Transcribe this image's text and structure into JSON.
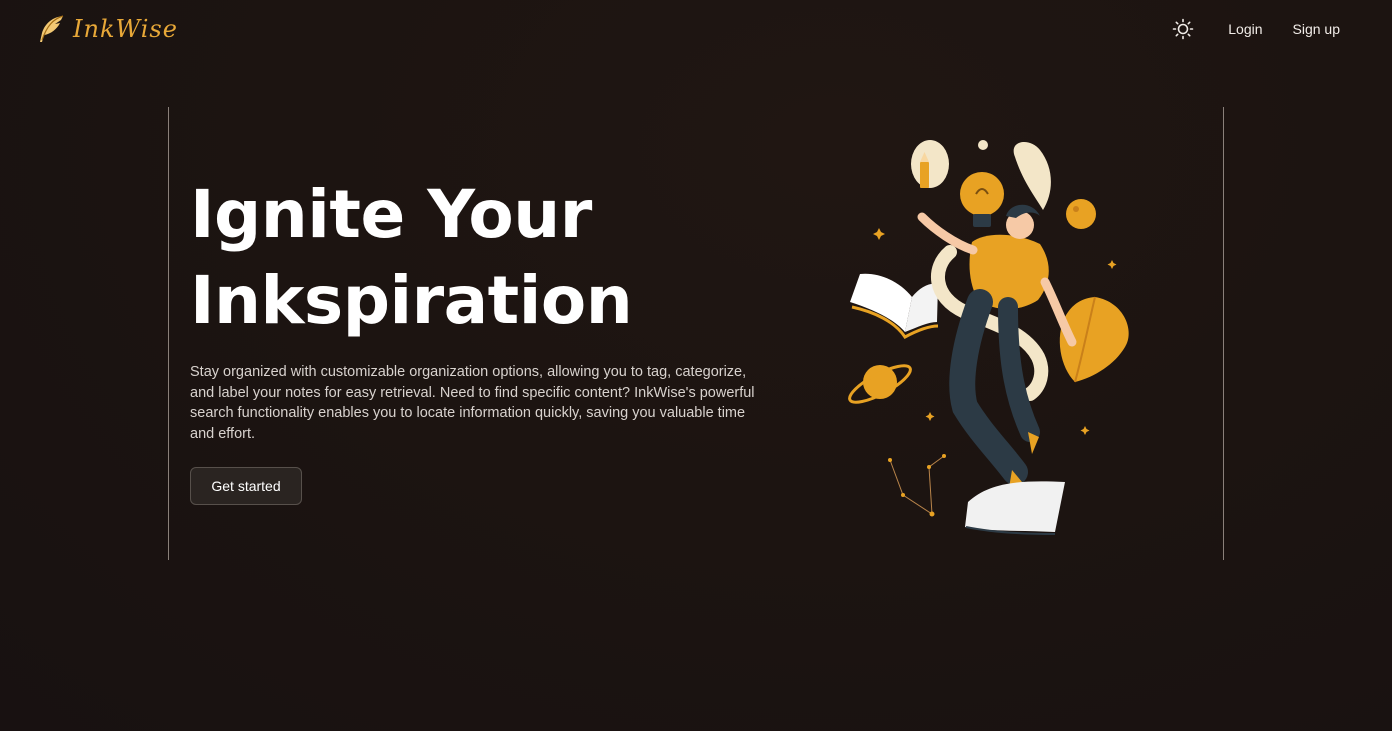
{
  "brand": {
    "name": "InkWise",
    "logo_icon": "quill-feather-icon",
    "accent_color": "#e8a838"
  },
  "nav": {
    "theme_toggle_icon": "sun-icon",
    "login_label": "Login",
    "signup_label": "Sign up"
  },
  "hero": {
    "title_line1": "Ignite Your",
    "title_line2": "Inkspiration",
    "description": "Stay organized with customizable organization options, allowing you to tag, categorize, and label your notes for easy retrieval. Need to find specific content? InkWise's powerful search functionality enables you to locate information quickly, saving you valuable time and effort.",
    "cta_label": "Get started",
    "illustration": "person-floating-with-books-lightbulb-planets-illustration"
  },
  "colors": {
    "background": "#1c1411",
    "accent": "#e8a838",
    "text": "#ffffff"
  }
}
